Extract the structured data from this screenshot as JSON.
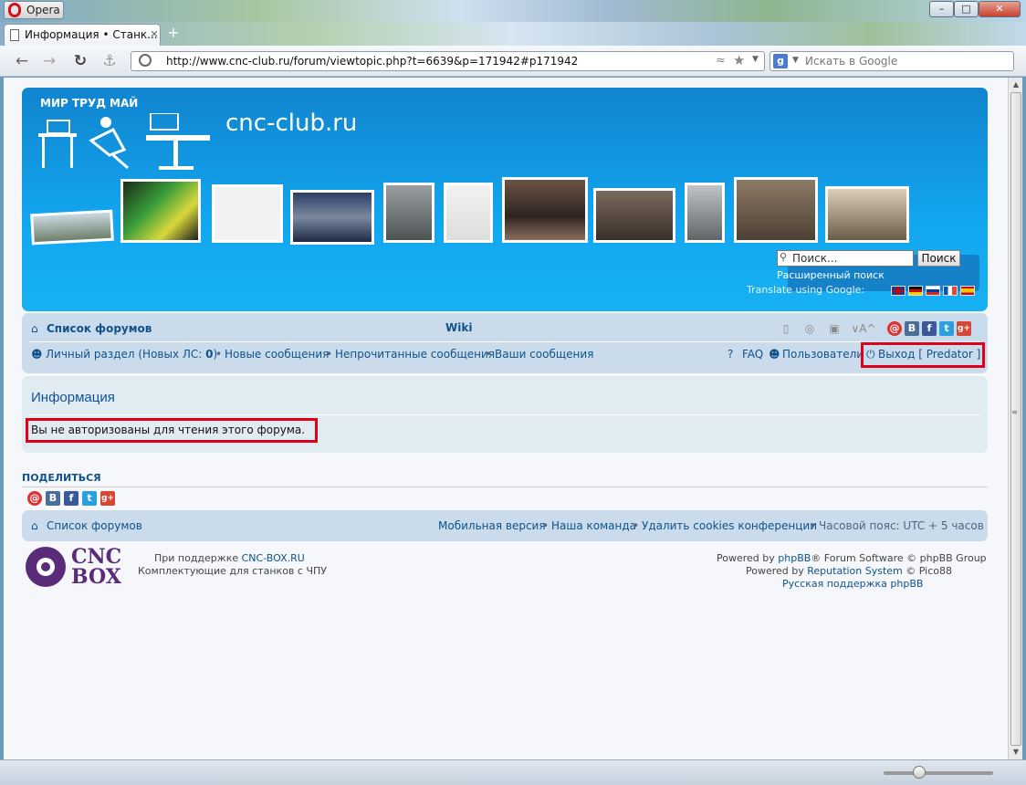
{
  "browser": {
    "menu_label": "Opera",
    "tab_title": "Информация • Станк...",
    "url": "http://www.cnc-club.ru/forum/viewtopic.php?t=6639&p=171942#p171942",
    "search_placeholder": "Искать в Google",
    "search_engine_letter": "g"
  },
  "header": {
    "slogan": "МИР ТРУД МАЙ",
    "site_title": "cnc-club.ru",
    "search_placeholder": "Поиск...",
    "search_button": "Поиск",
    "advanced_search": "Расширенный поиск",
    "translate_label": "Translate using Google:"
  },
  "nav": {
    "forum_index": "Список форумов",
    "wiki": "Wiki",
    "private_section": "Личный раздел (Новых ЛС: ",
    "private_count": "0",
    "private_close": ")",
    "sep": "•",
    "new_posts": "Новые сообщения",
    "unread_posts": "Непрочитанные сообщения",
    "your_posts": "Ваши сообщения",
    "faq": "FAQ",
    "members": "Пользователи",
    "logout": "Выход [ Predator ]",
    "font_size": "∨A^"
  },
  "info": {
    "title": "Информация",
    "message": "Вы не авторизованы для чтения этого форума."
  },
  "share": {
    "label": "ПОДЕЛИТЬСЯ"
  },
  "social": {
    "vk": "B",
    "fb": "f",
    "gplus": "g+"
  },
  "footer": {
    "forum_index": "Список форумов",
    "mobile": "Мобильная версия",
    "team": "Наша команда",
    "delete_cookies": "Удалить cookies конференции",
    "timezone": "Часовой пояс: UTC + 5 часов",
    "support_prefix": "При поддержке ",
    "support_link": "CNC-BOX.RU",
    "support_desc": "Комплектующие для станков с ЧПУ",
    "powered1_prefix": "Powered by ",
    "powered1_link": "phpBB",
    "powered1_suffix": "® Forum Software © phpBB Group",
    "powered2_prefix": "Powered by ",
    "powered2_link": "Reputation System",
    "powered2_suffix": " © Pico88",
    "ru_support": "Русская поддержка phpBB",
    "cnc_logo_line1": "CNC",
    "cnc_logo_line2": "BOX"
  },
  "colors": {
    "header_blue": "#12a6ef",
    "nav_bg": "#cadceb",
    "link": "#105289",
    "highlight_red": "#e0001a"
  }
}
